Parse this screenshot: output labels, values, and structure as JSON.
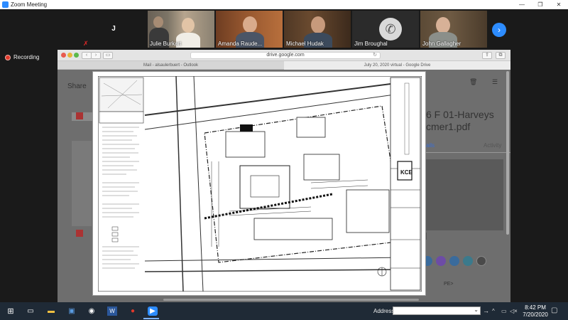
{
  "window": {
    "title": "Zoom Meeting",
    "controls": [
      "—",
      "❐",
      "✕"
    ]
  },
  "participants": [
    {
      "name": "J",
      "type": "initial"
    },
    {
      "name": "Julie Burkart",
      "type": "video"
    },
    {
      "name": "Amanda Raude...",
      "type": "video"
    },
    {
      "name": "Michael Hudak",
      "type": "video"
    },
    {
      "name": "Jim Broughal",
      "type": "phone"
    },
    {
      "name": "John Gallagher",
      "type": "video"
    }
  ],
  "recording": {
    "label": "Recording"
  },
  "browser": {
    "url": "drive.google.com",
    "tabs": [
      {
        "label": "Mail - alsaulerbuert - Outlook"
      },
      {
        "label": "July 20, 2020 virtual - Google Drive"
      }
    ]
  },
  "drive": {
    "shared_label": "Share",
    "file_title": "6 F 01-Harveys\ncmer1.pdf",
    "details_tab": "ails",
    "activity_tab": "Activity",
    "pe_label": "PE>"
  },
  "taskbar": {
    "address_label": "Address",
    "time": "8:42 PM",
    "date": "7/20/2020"
  },
  "colors": {
    "zoom_blue": "#2d8cff",
    "recording_red": "#e0392b",
    "taskbar_bg": "#1f2a36"
  }
}
